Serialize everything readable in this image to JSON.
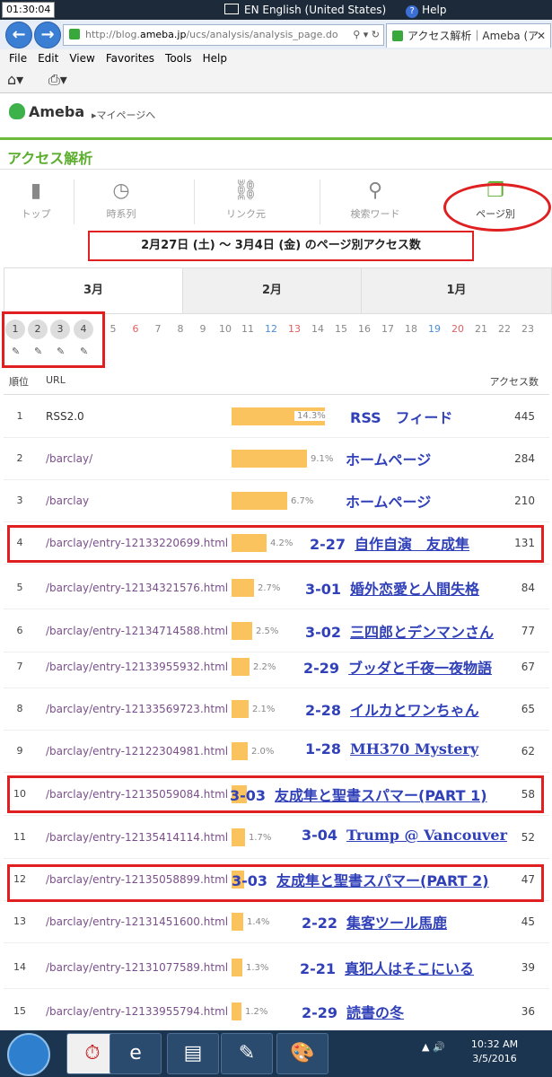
{
  "window": {
    "clock": "01:30:04",
    "lang": "EN English (United States)",
    "help": "Help"
  },
  "browser": {
    "url_prefix": "http://blog.",
    "url_domain": "ameba.jp",
    "url_rest": "/ucs/analysis/analysis_page.do",
    "tab_title": "アクセス解析｜Ameba (ア",
    "menu": [
      "File",
      "Edit",
      "View",
      "Favorites",
      "Tools",
      "Help"
    ]
  },
  "header": {
    "logo": "Ameba",
    "mypage": "▸マイページへ",
    "title": "アクセス解析"
  },
  "nav": [
    {
      "label": "トップ",
      "icon": "▮"
    },
    {
      "label": "時系列",
      "icon": "◷"
    },
    {
      "label": "リンク元",
      "icon": "⛓"
    },
    {
      "label": "検索ワード",
      "icon": "⚲"
    },
    {
      "label": "ページ別",
      "icon": "❐"
    }
  ],
  "daterange": "2月27日 (土) ～ 3月4日 (金) のページ別アクセス数",
  "months": [
    "3月",
    "2月",
    "1月"
  ],
  "days": [
    "1",
    "2",
    "3",
    "4",
    "5",
    "6",
    "7",
    "8",
    "9",
    "10",
    "11",
    "12",
    "13",
    "14",
    "15",
    "16",
    "17",
    "18",
    "19",
    "20",
    "21",
    "22",
    "23"
  ],
  "table": {
    "headers": {
      "rank": "順位",
      "url": "URL",
      "count": "アクセス数"
    },
    "rows": [
      {
        "rank": "1",
        "url": "RSS2.0",
        "pct": "14.3%",
        "count": "445",
        "date": "",
        "title": "RSS　フィード"
      },
      {
        "rank": "2",
        "url": "/barclay/",
        "pct": "9.1%",
        "count": "284",
        "date": "",
        "title": "ホームページ"
      },
      {
        "rank": "3",
        "url": "/barclay",
        "pct": "6.7%",
        "count": "210",
        "date": "",
        "title": "ホームページ"
      },
      {
        "rank": "4",
        "url": "/barclay/entry-12133220699.html",
        "pct": "4.2%",
        "count": "131",
        "date": "2-27",
        "title": "自作自演　友成隼"
      },
      {
        "rank": "5",
        "url": "/barclay/entry-12134321576.html",
        "pct": "2.7%",
        "count": "84",
        "date": "3-01",
        "title": "婚外恋愛と人間失格"
      },
      {
        "rank": "6",
        "url": "/barclay/entry-12134714588.html",
        "pct": "2.5%",
        "count": "77",
        "date": "3-02",
        "title": "三四郎とデンマンさん"
      },
      {
        "rank": "7",
        "url": "/barclay/entry-12133955932.html",
        "pct": "2.2%",
        "count": "67",
        "date": "2-29",
        "title": "ブッダと千夜一夜物語"
      },
      {
        "rank": "8",
        "url": "/barclay/entry-12133569723.html",
        "pct": "2.1%",
        "count": "65",
        "date": "2-28",
        "title": "イルカとワンちゃん"
      },
      {
        "rank": "9",
        "url": "/barclay/entry-12122304981.html",
        "pct": "2.0%",
        "count": "62",
        "date": "1-28",
        "title": "MH370 Mystery"
      },
      {
        "rank": "10",
        "url": "/barclay/entry-12135059084.html",
        "pct": "",
        "count": "58",
        "date": "3-03",
        "title": "友成隼と聖書スパマー(PART 1)"
      },
      {
        "rank": "11",
        "url": "/barclay/entry-12135414114.html",
        "pct": "1.7%",
        "count": "52",
        "date": "3-04",
        "title": "Trump @ Vancouver"
      },
      {
        "rank": "12",
        "url": "/barclay/entry-12135058899.html",
        "pct": "",
        "count": "47",
        "date": "3-03",
        "title": "友成隼と聖書スパマー(PART 2)"
      },
      {
        "rank": "13",
        "url": "/barclay/entry-12131451600.html",
        "pct": "1.4%",
        "count": "45",
        "date": "2-22",
        "title": "集客ツール馬鹿"
      },
      {
        "rank": "14",
        "url": "/barclay/entry-12131077589.html",
        "pct": "1.3%",
        "count": "39",
        "date": "2-21",
        "title": "真犯人はそこにいる"
      },
      {
        "rank": "15",
        "url": "/barclay/entry-12133955794.html",
        "pct": "1.2%",
        "count": "36",
        "date": "2-29",
        "title": "読書の冬"
      }
    ]
  },
  "taskbar": {
    "time": "10:32 AM",
    "date": "3/5/2016"
  }
}
